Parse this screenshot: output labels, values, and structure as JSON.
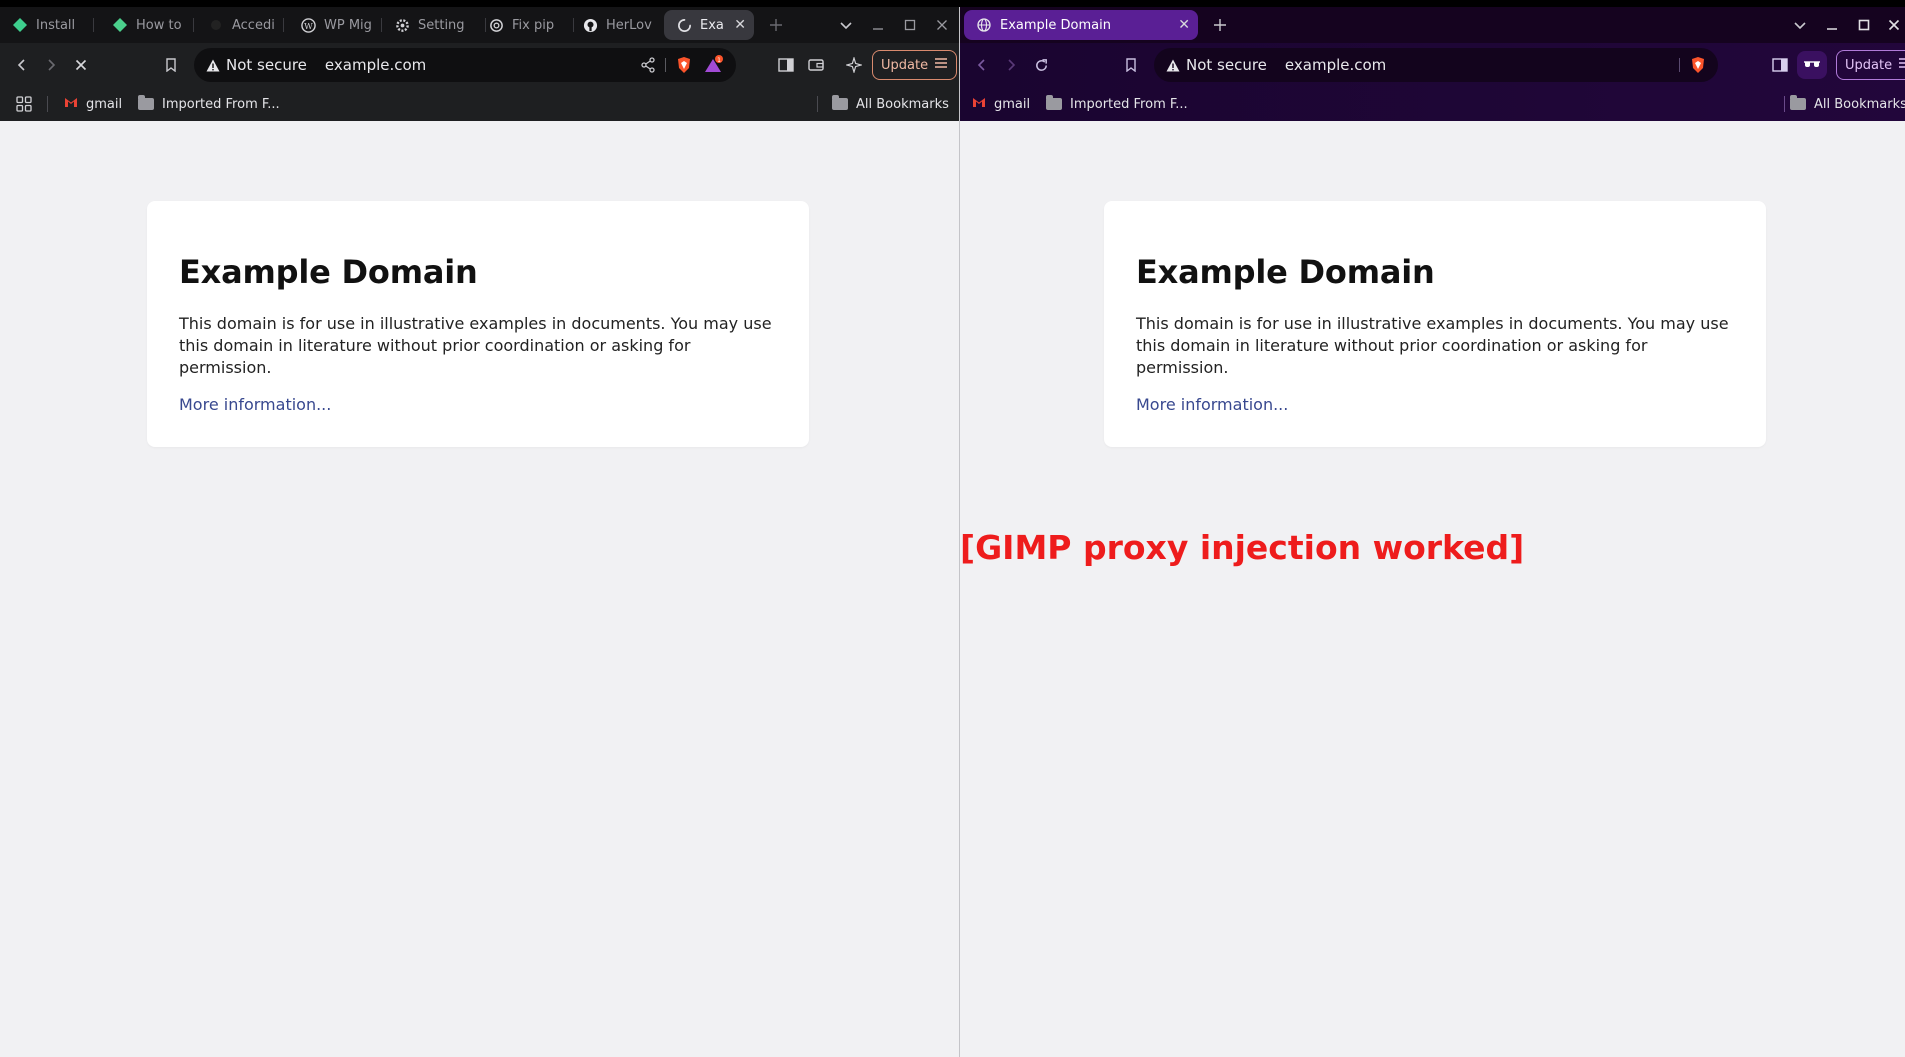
{
  "left_window": {
    "tabs": [
      {
        "label": "Install",
        "icon": "app-icon"
      },
      {
        "label": "How to",
        "icon": "app-icon"
      },
      {
        "label": "Accedi",
        "icon": "app-icon"
      },
      {
        "label": "WP Mig",
        "icon": "wordpress-icon"
      },
      {
        "label": "Setting",
        "icon": "gear-icon"
      },
      {
        "label": "Fix pip",
        "icon": "openai-icon"
      },
      {
        "label": "HerLov",
        "icon": "github-icon"
      },
      {
        "label": "Exa",
        "icon": "loading-icon",
        "active": true
      }
    ],
    "address": {
      "security": "Not secure",
      "host": "example.com"
    },
    "update_label": "Update",
    "shields_badge": "1",
    "bookmarks": {
      "apps": "",
      "gmail": "gmail",
      "imported": "Imported From F...",
      "all": "All Bookmarks"
    }
  },
  "right_window": {
    "tabs": [
      {
        "label": "Example Domain",
        "icon": "globe-icon",
        "active": true
      }
    ],
    "address": {
      "security": "Not secure",
      "host": "example.com"
    },
    "update_label": "Update",
    "bookmarks": {
      "gmail": "gmail",
      "imported": "Imported From F...",
      "all": "All Bookmarks"
    }
  },
  "page": {
    "title": "Example Domain",
    "body": "This domain is for use in illustrative examples in documents. You may use this domain in literature without prior coordination or asking for permission.",
    "link": "More information..."
  },
  "injection_text": "[GIMP proxy injection worked]",
  "colors": {
    "link": "#38488f",
    "injection": "#ee1c1c",
    "private_accent": "#5a1f95",
    "update_border": "#d98a6e"
  }
}
